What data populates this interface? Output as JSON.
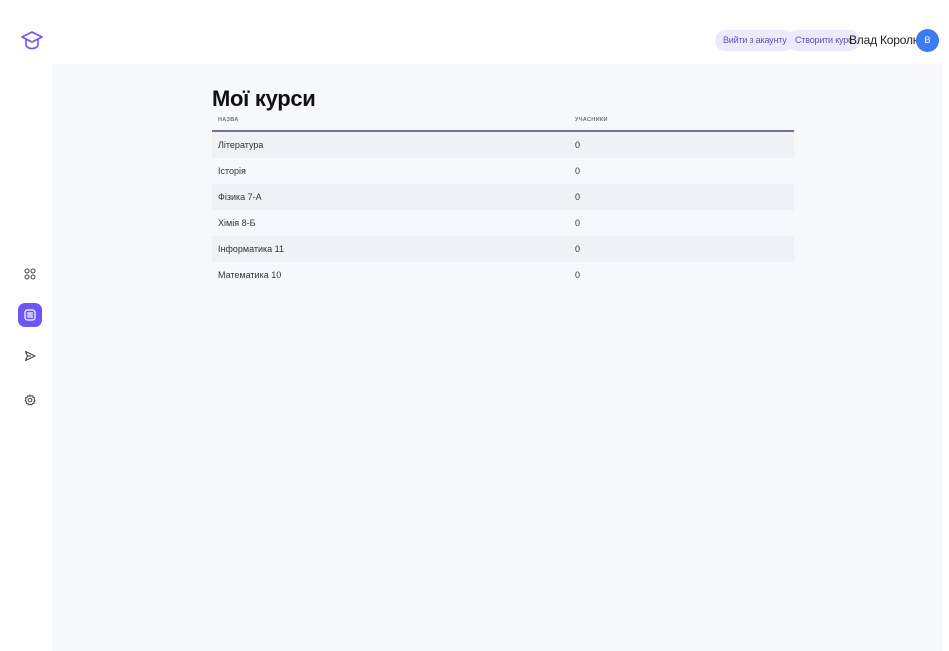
{
  "header": {
    "logout_label": "Вийти з акаунту",
    "create_course_label": "Створити курс",
    "user_name": "Влад Королюк",
    "avatar_initial": "В"
  },
  "sidebar": {
    "logo_icon": "graduation-cap-icon",
    "items": [
      {
        "icon": "grid-icon",
        "active": false
      },
      {
        "icon": "list-icon",
        "active": true
      },
      {
        "icon": "send-icon",
        "active": false
      },
      {
        "icon": "gear-icon",
        "active": false
      }
    ]
  },
  "main": {
    "title": "Мої курси",
    "table": {
      "columns": [
        "НАЗВА",
        "УЧАСНИКИ"
      ],
      "rows": [
        {
          "name": "Література",
          "members": "0"
        },
        {
          "name": "Історія",
          "members": "0"
        },
        {
          "name": "Фізика 7-А",
          "members": "0"
        },
        {
          "name": "Хімія 8-Б",
          "members": "0"
        },
        {
          "name": "Інформатика 11",
          "members": "0"
        },
        {
          "name": "Математика 10",
          "members": "0"
        }
      ]
    }
  },
  "colors": {
    "accent": "#6b57f5",
    "avatar": "#3b7cf1",
    "pill_bg": "#ebeaff",
    "main_bg": "#f7f8fb",
    "row_alt": "#eef1f5"
  }
}
